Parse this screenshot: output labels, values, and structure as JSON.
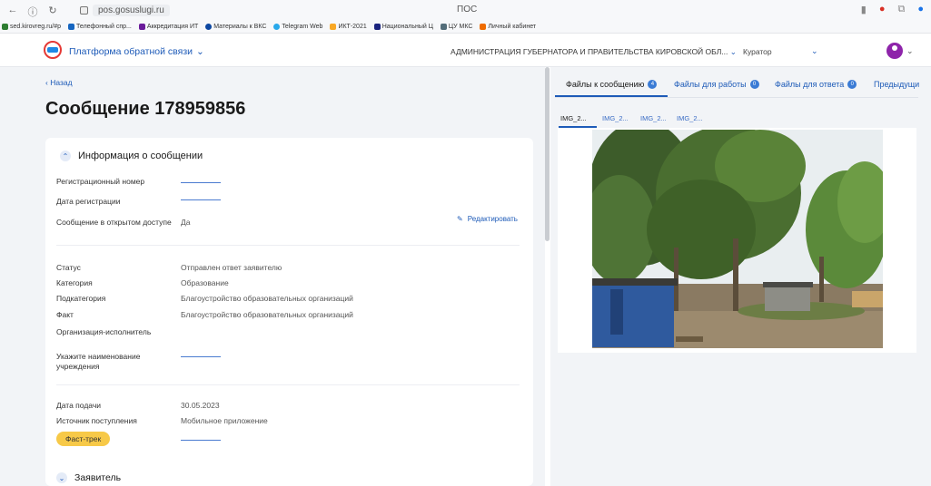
{
  "browser": {
    "url": "pos.gosuslugi.ru",
    "window_title": "ПОС",
    "bookmarks": [
      "sed.kirovreg.ru/#p",
      "Телефонный спр...",
      "Аккредитация ИТ",
      "Материалы к ВКС",
      "Telegram Web",
      "ИКТ-2021",
      "Национальный Ц",
      "ЦУ МКС",
      "Личный кабинет"
    ]
  },
  "header": {
    "platform_label": "Платформа обратной связи",
    "organization": "АДМИНИСТРАЦИЯ ГУБЕРНАТОРА И ПРАВИТЕЛЬСТВА КИРОВСКОЙ ОБЛ...",
    "role": "Куратор"
  },
  "page": {
    "back_label": "Назад",
    "title": "Сообщение 178959856"
  },
  "info": {
    "section_title": "Информация о сообщении",
    "reg_number_label": "Регистрационный номер",
    "reg_date_label": "Дата регистрации",
    "public_access_label": "Сообщение в открытом доступе",
    "public_access_value": "Да",
    "edit_label": "Редактировать",
    "status_label": "Статус",
    "status_value": "Отправлен ответ заявителю",
    "category_label": "Категория",
    "category_value": "Образование",
    "subcategory_label": "Подкатегория",
    "subcategory_value": "Благоустройство образовательных организаций",
    "fact_label": "Факт",
    "fact_value": "Благоустройство образовательных организаций",
    "org_exec_label": "Организация-исполнитель",
    "institution_label": "Укажите наименование учреждения",
    "submit_date_label": "Дата подачи",
    "submit_date_value": "30.05.2023",
    "source_label": "Источник поступления",
    "source_value": "Мобильное приложение",
    "fast_track_label": "Фаст-трек"
  },
  "applicant": {
    "section_title": "Заявитель"
  },
  "right_panel": {
    "tabs": [
      {
        "label": "Файлы к сообщению",
        "count": "4"
      },
      {
        "label": "Файлы для работы",
        "count": "0"
      },
      {
        "label": "Файлы для ответа",
        "count": "0"
      },
      {
        "label": "Предыдущи"
      }
    ],
    "files": [
      "IMG_2...",
      "IMG_2...",
      "IMG_2...",
      "IMG_2..."
    ]
  },
  "colors": {
    "accent": "#1e5bb8",
    "badge": "#f7c948",
    "background": "#f2f4f7"
  }
}
